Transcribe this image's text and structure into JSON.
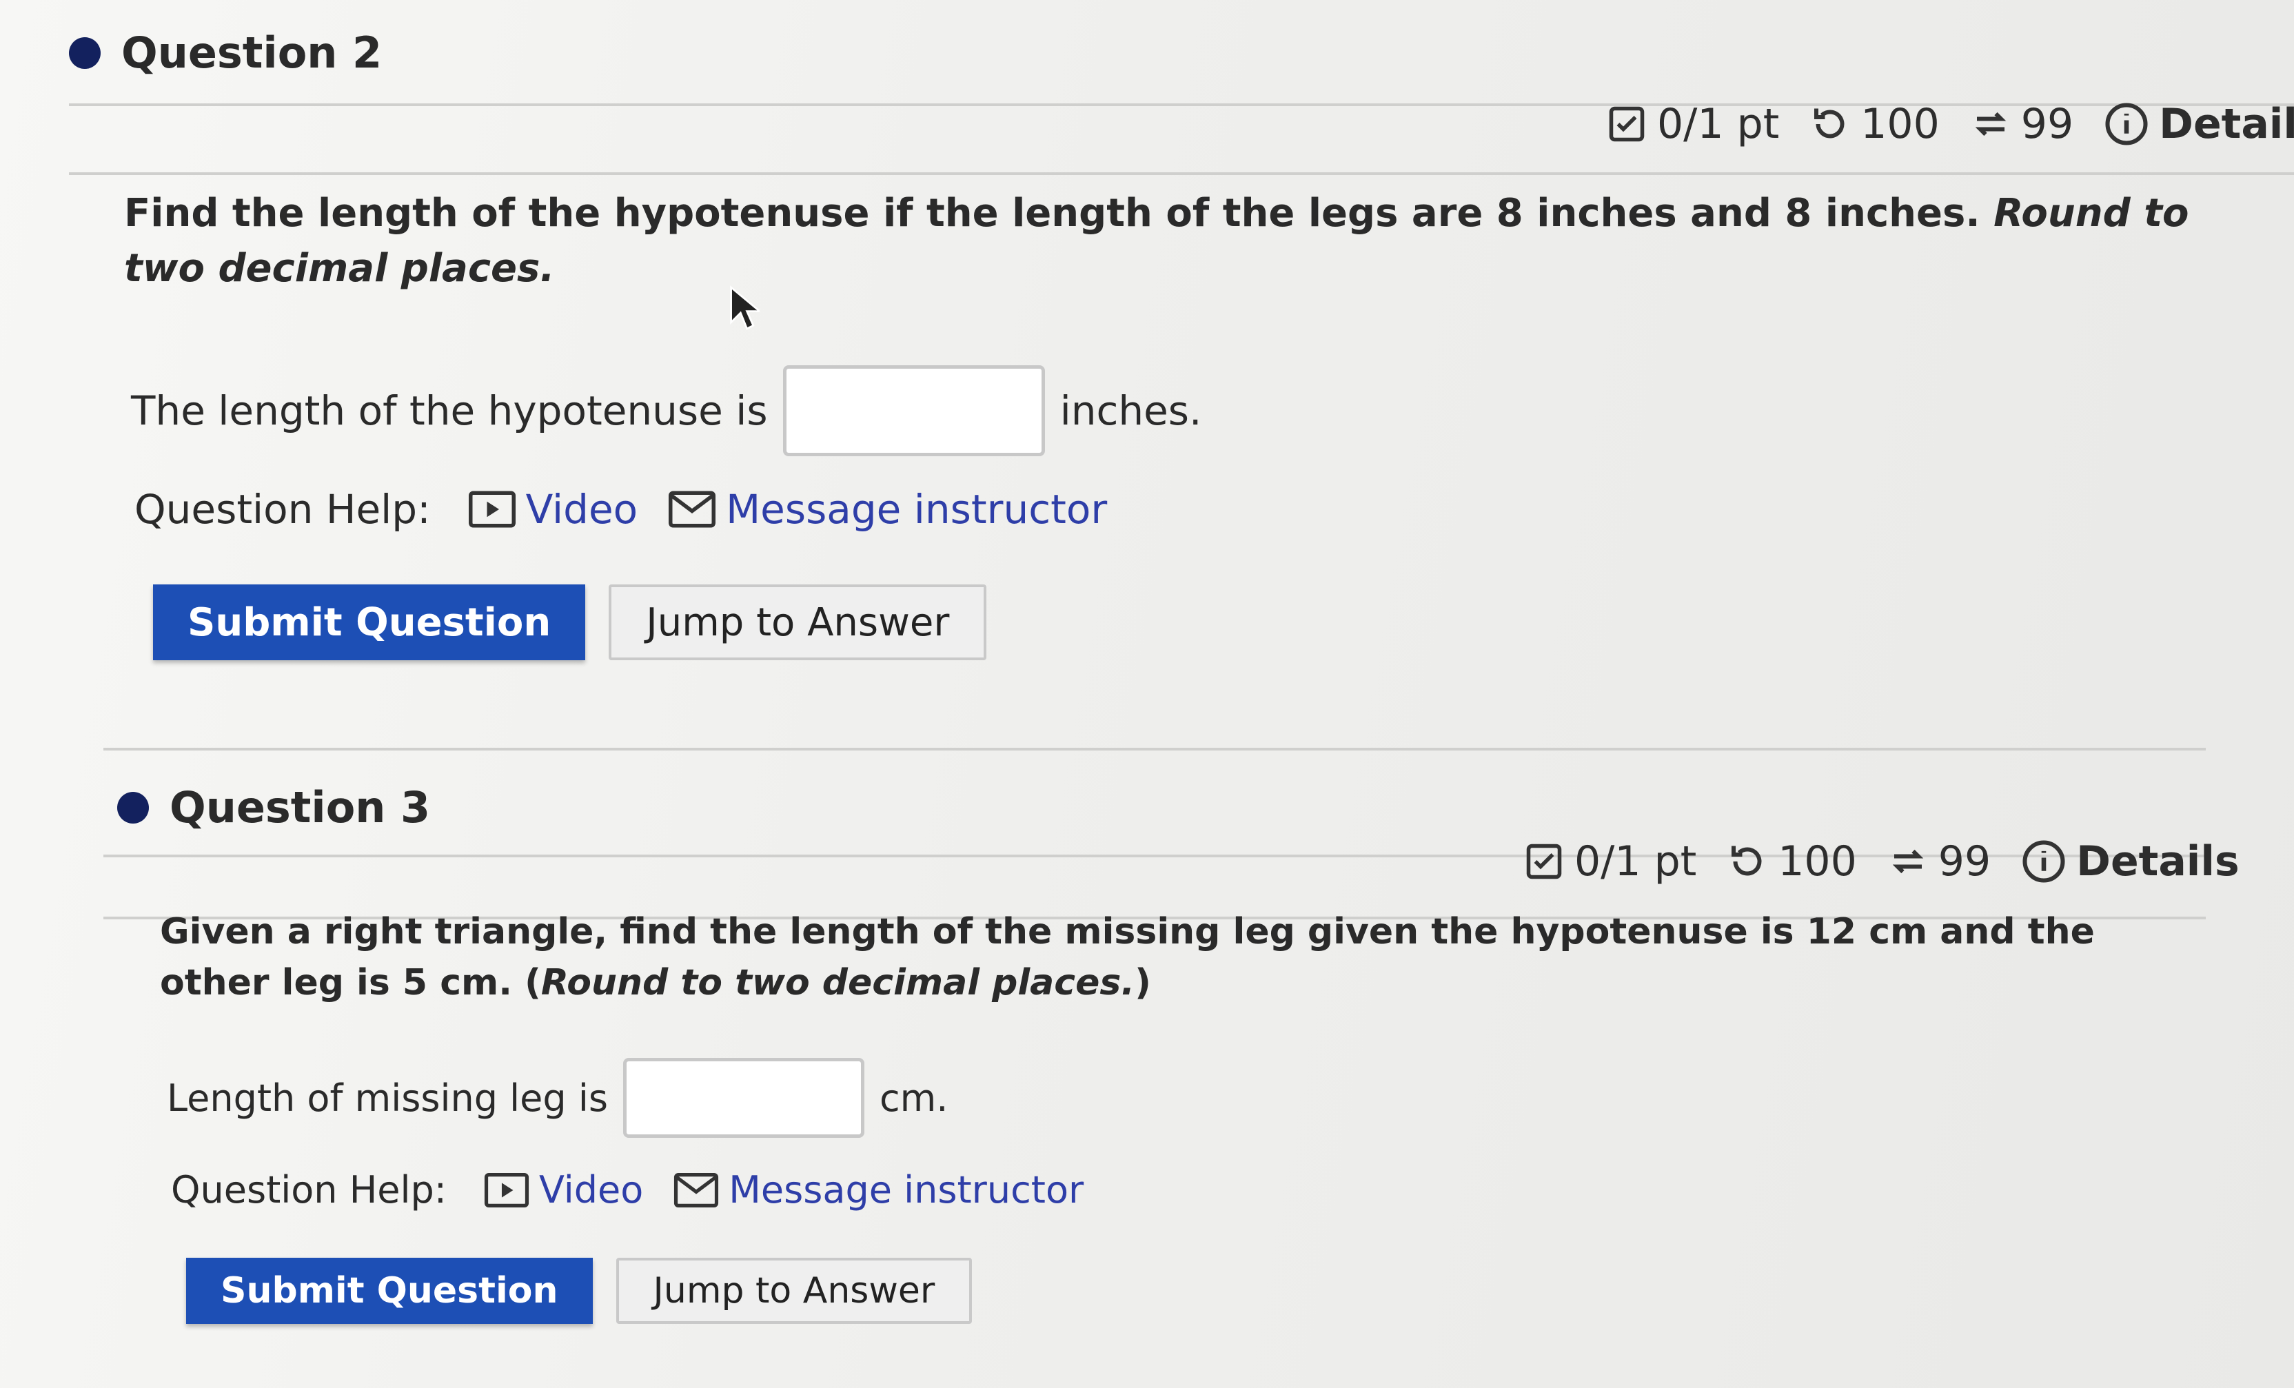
{
  "questions": [
    {
      "title": "Question 2",
      "score": "0/1 pt",
      "retries": "100",
      "attempts": "99",
      "details": "Details",
      "prompt_main": "Find the length of the hypotenuse if the length of the legs are 8 inches and 8 inches.",
      "prompt_round": "Round to two decimal places.",
      "answer_prefix": "The length of the hypotenuse is",
      "answer_value": "",
      "answer_suffix": "inches.",
      "help_label": "Question Help:",
      "video_label": "Video",
      "message_label": "Message instructor",
      "submit_label": "Submit Question",
      "jump_label": "Jump to Answer"
    },
    {
      "title": "Question 3",
      "score": "0/1 pt",
      "retries": "100",
      "attempts": "99",
      "details": "Details",
      "prompt_main": "Given a right triangle, find the length of the missing leg given the hypotenuse is 12 cm and the other leg is 5 cm. (",
      "prompt_round": "Round to two decimal places.",
      "prompt_close": ")",
      "answer_prefix": "Length of missing leg is",
      "answer_value": "",
      "answer_suffix": "cm.",
      "help_label": "Question Help:",
      "video_label": "Video",
      "message_label": "Message instructor",
      "submit_label": "Submit Question",
      "jump_label": "Jump to Answer"
    }
  ],
  "colors": {
    "primary_button": "#1d4fb5",
    "link": "#2e3ea8",
    "bullet": "#13215e"
  },
  "icons": {
    "score": "checkbox-icon",
    "retries": "retry-icon",
    "attempts": "repeat-icon",
    "details": "info-icon",
    "video": "video-icon",
    "message": "envelope-icon"
  }
}
